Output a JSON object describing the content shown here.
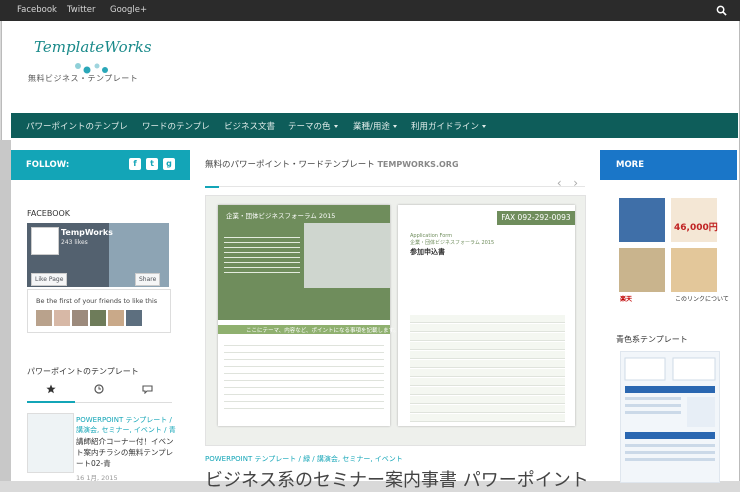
{
  "topbar": {
    "links": [
      "Facebook",
      "Twitter",
      "Google+"
    ],
    "search_icon": "search-icon"
  },
  "logo": {
    "name": "TemplateWorks",
    "tagline": "無料ビジネス・テンプレート"
  },
  "nav": {
    "items": [
      {
        "label": "パワーポイントのテンプレ"
      },
      {
        "label": "ワードのテンプレ"
      },
      {
        "label": "ビジネス文書"
      },
      {
        "label": "テーマの色"
      },
      {
        "label": "業種/用途"
      },
      {
        "label": "利用ガイドライン"
      }
    ]
  },
  "left": {
    "follow_label": "FOLLOW:",
    "social_icons": [
      "facebook-icon",
      "twitter-icon",
      "googleplus-icon"
    ],
    "facebook_heading": "FACEBOOK",
    "fb_page_name": "TempWorks",
    "fb_likes": "243 likes",
    "fb_like_button": "Like Page",
    "fb_share_button": "Share",
    "fb_friends_text": "Be the first of your friends to like this",
    "pp_heading": "パワーポイントのテンプレート",
    "tabs": [
      "star-icon",
      "clock-icon",
      "comment-icon"
    ],
    "post": {
      "category": "POWERPOINT テンプレート / 講演会, セミナー, イベント / 青",
      "title": "講師紹介コーナー付！イベント案内チラシの無料テンプレート02-青",
      "date": "16 1月, 2015"
    }
  },
  "main": {
    "heading": "無料のパワーポイント・ワードテンプレート",
    "site": "TEMPWORKS.ORG",
    "slide": {
      "doc1_title": "企業・団体ビジネスフォーラム 2015",
      "doc1_bar": "ここにテーマ、内容など、ポイントになる事項を記載します。",
      "doc2_fax": "FAX 092-292-0093",
      "doc2_small": "Application Form\n企業・団体ビジネスフォーラム 2015",
      "doc2_big": "参加申込書"
    },
    "meta": "POWERPOINT テンプレート / 緑 / 講演会, セミナー, イベント",
    "title": "ビジネス系のセミナー案内事書 パワーポイント"
  },
  "right": {
    "more_label": "MORE",
    "ad_price": "46,000円",
    "ad_brand": "楽天",
    "ad_caption": "このリンクについて",
    "aocolor_heading": "青色系テンプレート"
  },
  "colors": {
    "nav_bg": "#0e5d5a",
    "follow_bg": "#13a5b7",
    "more_bg": "#1a76c8",
    "topbar_bg": "#2b2b2b",
    "slide_green": "#6f8d5c"
  }
}
